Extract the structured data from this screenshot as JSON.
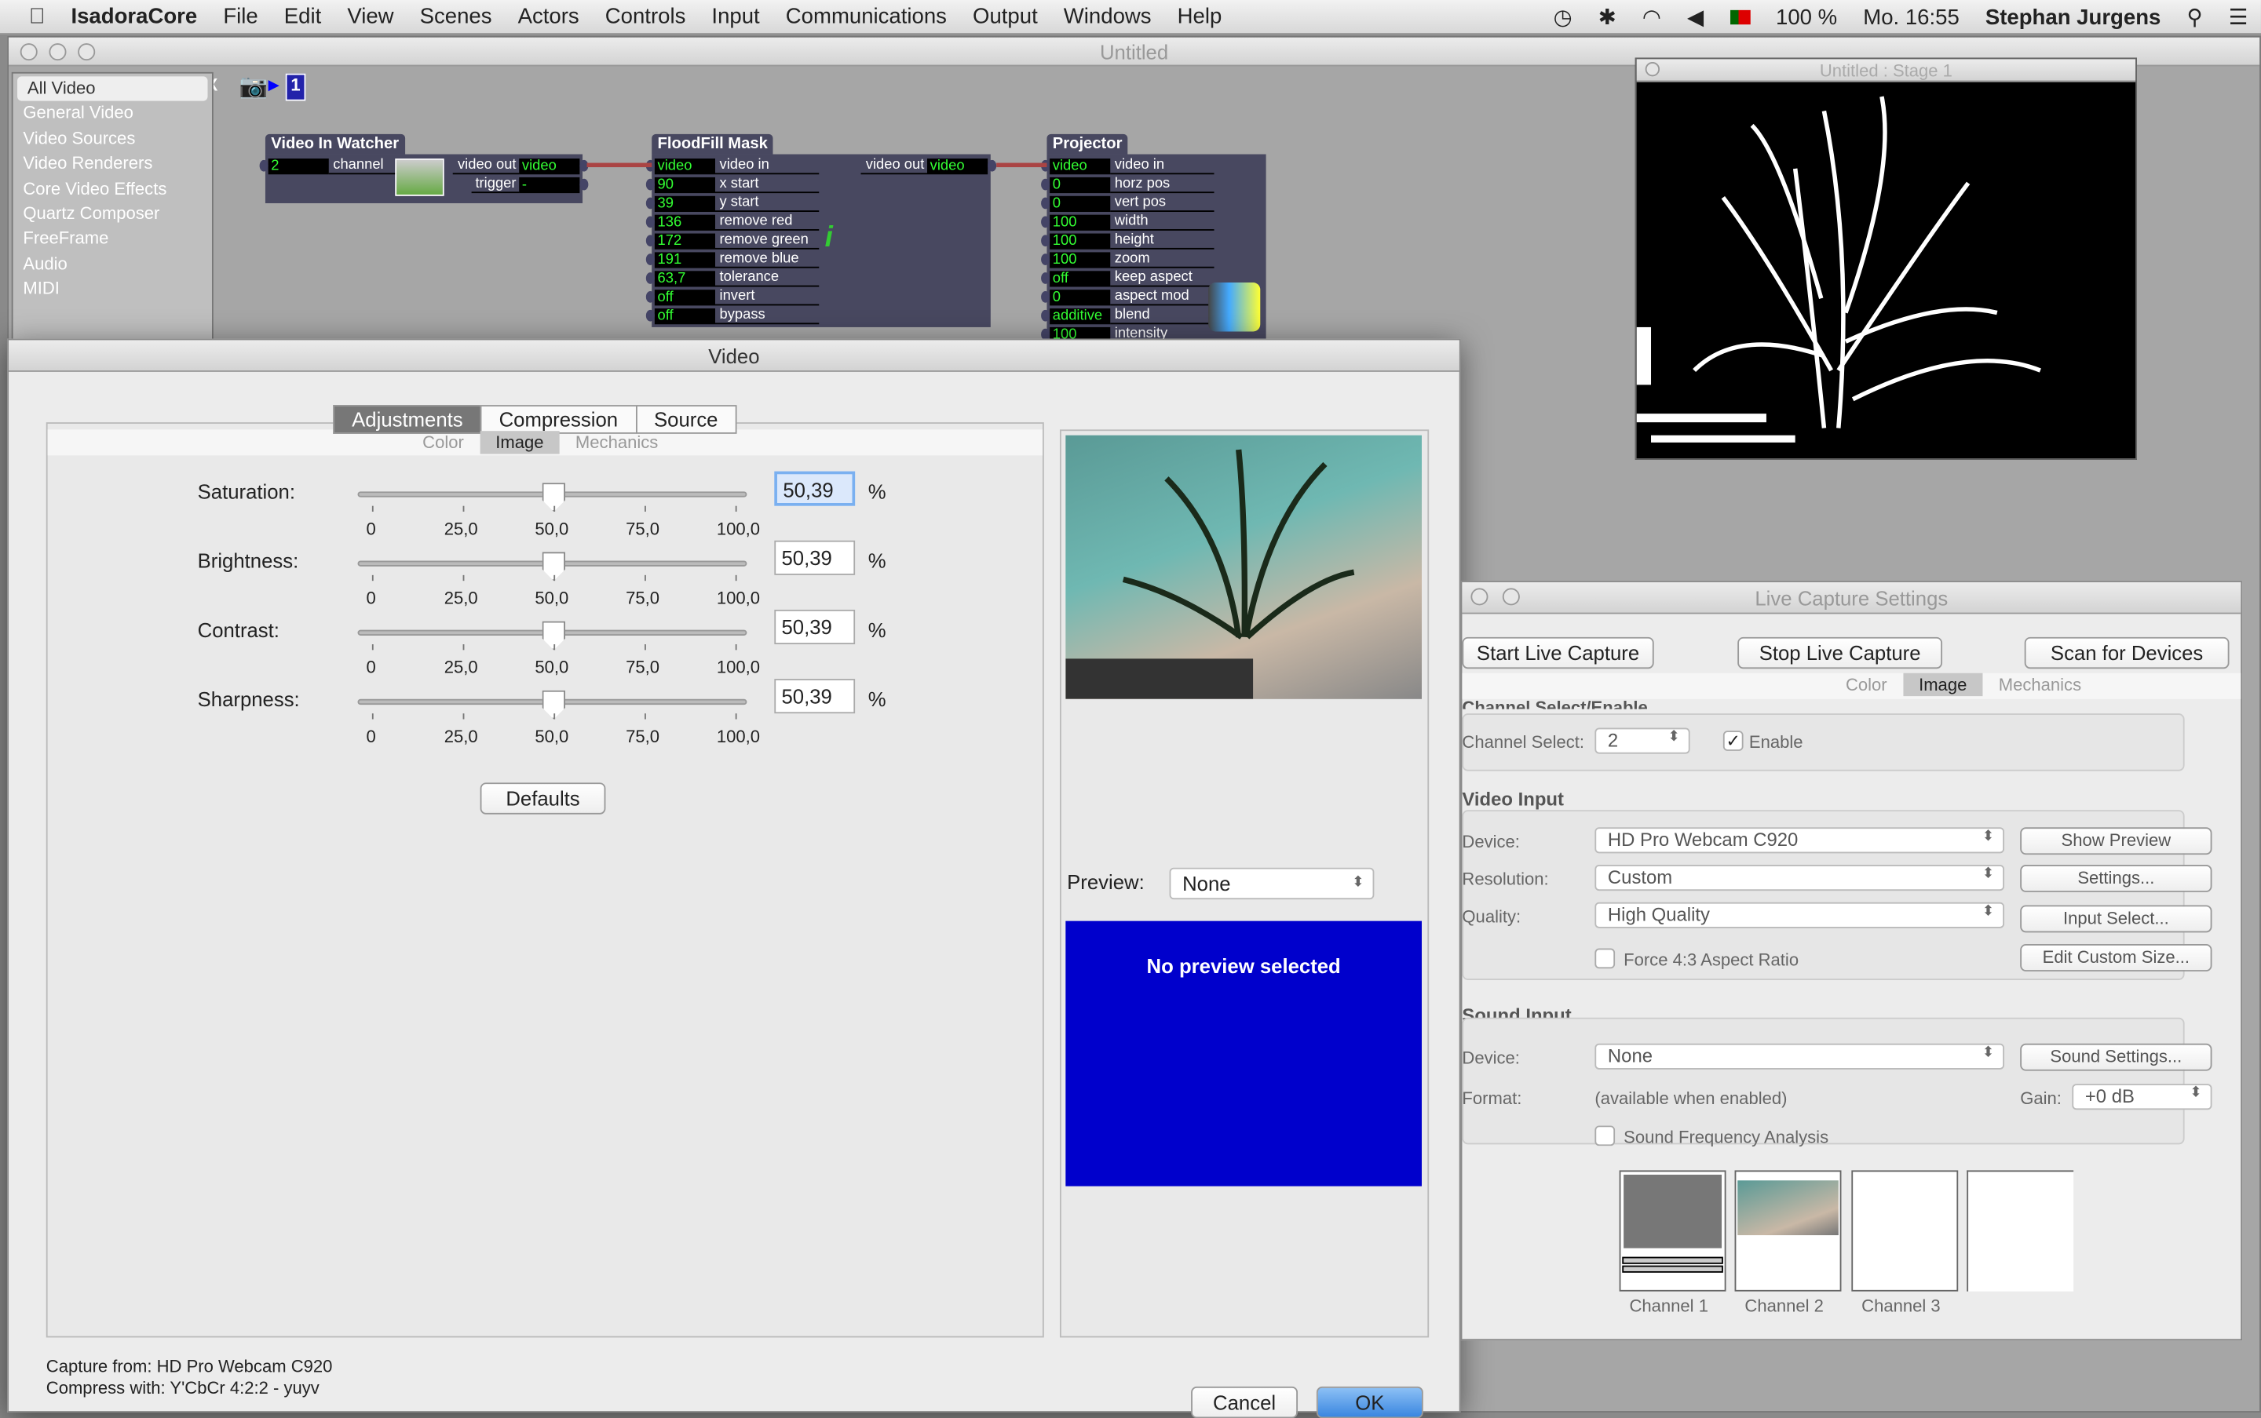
{
  "menubar": {
    "app": "IsadoraCore",
    "items": [
      "File",
      "Edit",
      "View",
      "Scenes",
      "Actors",
      "Controls",
      "Input",
      "Communications",
      "Output",
      "Windows",
      "Help"
    ],
    "battery": "100 %",
    "clock": "Mo. 16:55",
    "user": "Stephan Jurgens"
  },
  "main_window": {
    "title": "Untitled",
    "search_clear": "X",
    "scene_number": "1",
    "sidebar": [
      "All Video",
      "General Video",
      "Video Sources",
      "Video Renderers",
      "Core Video Effects",
      "Quartz Composer",
      "FreeFrame",
      "Audio",
      "MIDI"
    ],
    "nodes": [
      {
        "title": "Video In Watcher",
        "inputs": [
          [
            "2",
            "channel"
          ]
        ],
        "outputs": [
          [
            "video out",
            "video"
          ],
          [
            "trigger",
            "-"
          ]
        ]
      },
      {
        "title": "FloodFill Mask",
        "inputs": [
          [
            "video",
            "video in"
          ],
          [
            "90",
            "x start"
          ],
          [
            "39",
            "y start"
          ],
          [
            "136",
            "remove red"
          ],
          [
            "172",
            "remove green"
          ],
          [
            "191",
            "remove blue"
          ],
          [
            "63,7",
            "tolerance"
          ],
          [
            "off",
            "invert"
          ],
          [
            "off",
            "bypass"
          ]
        ],
        "outputs": [
          [
            "video out",
            "video"
          ]
        ]
      },
      {
        "title": "Projector",
        "inputs": [
          [
            "video",
            "video in"
          ],
          [
            "0",
            "horz pos"
          ],
          [
            "0",
            "vert pos"
          ],
          [
            "100",
            "width"
          ],
          [
            "100",
            "height"
          ],
          [
            "100",
            "zoom"
          ],
          [
            "off",
            "keep aspect"
          ],
          [
            "0",
            "aspect mod"
          ],
          [
            "additive",
            "blend"
          ],
          [
            "100",
            "intensity"
          ]
        ]
      }
    ]
  },
  "stage": {
    "title": "Untitled : Stage 1"
  },
  "video_dialog": {
    "title": "Video",
    "tabs": [
      "Adjustments",
      "Compression",
      "Source"
    ],
    "active_tab": "Adjustments",
    "subtabs": [
      "Color",
      "Image",
      "Mechanics"
    ],
    "active_subtab": "Image",
    "sliders": [
      {
        "label": "Saturation:",
        "value": "50,39",
        "percent": 50.39
      },
      {
        "label": "Brightness:",
        "value": "50,39",
        "percent": 50.39
      },
      {
        "label": "Contrast:",
        "value": "50,39",
        "percent": 50.39
      },
      {
        "label": "Sharpness:",
        "value": "50,39",
        "percent": 50.39
      }
    ],
    "ticks": [
      "0",
      "25,0",
      "50,0",
      "75,0",
      "100,0"
    ],
    "unit": "%",
    "defaults": "Defaults",
    "preview_label": "Preview:",
    "preview_value": "None",
    "no_preview": "No preview selected",
    "capture_from": "Capture from: HD Pro Webcam C920",
    "compress_with": "Compress with: Y'CbCr 4:2:2 - yuyv",
    "cancel": "Cancel",
    "ok": "OK",
    "colors": {
      "preview_bg": "#0000cc"
    }
  },
  "live_capture": {
    "title": "Live Capture Settings",
    "start": "Start Live Capture",
    "stop": "Stop Live Capture",
    "scan": "Scan for Devices",
    "subtabs": [
      "Color",
      "Image",
      "Mechanics"
    ],
    "active_subtab": "Image",
    "group_channel": "Channel Select/Enable",
    "channel_select_label": "Channel Select:",
    "channel_select": "2",
    "enable": "Enable",
    "enable_checked": true,
    "video_input": "Video Input",
    "device_label": "Device:",
    "device": "HD Pro Webcam C920",
    "resolution_label": "Resolution:",
    "resolution": "Custom",
    "quality_label": "Quality:",
    "quality": "High Quality",
    "force43": "Force 4:3 Aspect Ratio",
    "show_preview": "Show Preview",
    "settings": "Settings...",
    "input_select": "Input Select...",
    "edit_custom": "Edit Custom Size...",
    "sound_input": "Sound Input",
    "sound_device_label": "Device:",
    "sound_device": "None",
    "sound_settings": "Sound Settings...",
    "format_label": "Format:",
    "format": "(available when enabled)",
    "gain_label": "Gain:",
    "gain": "+0 dB",
    "sfa": "Sound Frequency Analysis",
    "channels": [
      "Channel 1",
      "Channel 2",
      "Channel 3"
    ]
  }
}
